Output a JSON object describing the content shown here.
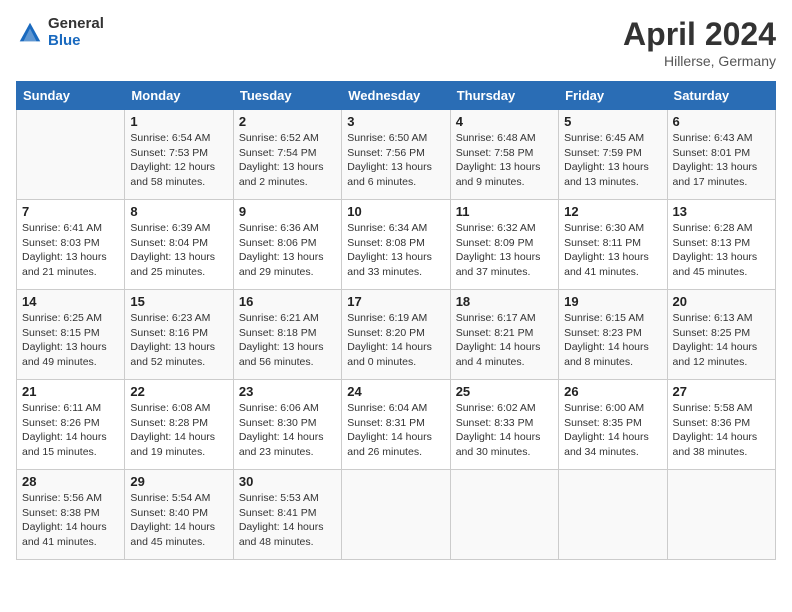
{
  "header": {
    "logo_general": "General",
    "logo_blue": "Blue",
    "month_title": "April 2024",
    "location": "Hillerse, Germany"
  },
  "days_of_week": [
    "Sunday",
    "Monday",
    "Tuesday",
    "Wednesday",
    "Thursday",
    "Friday",
    "Saturday"
  ],
  "weeks": [
    [
      {
        "day": "",
        "info": ""
      },
      {
        "day": "1",
        "info": "Sunrise: 6:54 AM\nSunset: 7:53 PM\nDaylight: 12 hours\nand 58 minutes."
      },
      {
        "day": "2",
        "info": "Sunrise: 6:52 AM\nSunset: 7:54 PM\nDaylight: 13 hours\nand 2 minutes."
      },
      {
        "day": "3",
        "info": "Sunrise: 6:50 AM\nSunset: 7:56 PM\nDaylight: 13 hours\nand 6 minutes."
      },
      {
        "day": "4",
        "info": "Sunrise: 6:48 AM\nSunset: 7:58 PM\nDaylight: 13 hours\nand 9 minutes."
      },
      {
        "day": "5",
        "info": "Sunrise: 6:45 AM\nSunset: 7:59 PM\nDaylight: 13 hours\nand 13 minutes."
      },
      {
        "day": "6",
        "info": "Sunrise: 6:43 AM\nSunset: 8:01 PM\nDaylight: 13 hours\nand 17 minutes."
      }
    ],
    [
      {
        "day": "7",
        "info": "Sunrise: 6:41 AM\nSunset: 8:03 PM\nDaylight: 13 hours\nand 21 minutes."
      },
      {
        "day": "8",
        "info": "Sunrise: 6:39 AM\nSunset: 8:04 PM\nDaylight: 13 hours\nand 25 minutes."
      },
      {
        "day": "9",
        "info": "Sunrise: 6:36 AM\nSunset: 8:06 PM\nDaylight: 13 hours\nand 29 minutes."
      },
      {
        "day": "10",
        "info": "Sunrise: 6:34 AM\nSunset: 8:08 PM\nDaylight: 13 hours\nand 33 minutes."
      },
      {
        "day": "11",
        "info": "Sunrise: 6:32 AM\nSunset: 8:09 PM\nDaylight: 13 hours\nand 37 minutes."
      },
      {
        "day": "12",
        "info": "Sunrise: 6:30 AM\nSunset: 8:11 PM\nDaylight: 13 hours\nand 41 minutes."
      },
      {
        "day": "13",
        "info": "Sunrise: 6:28 AM\nSunset: 8:13 PM\nDaylight: 13 hours\nand 45 minutes."
      }
    ],
    [
      {
        "day": "14",
        "info": "Sunrise: 6:25 AM\nSunset: 8:15 PM\nDaylight: 13 hours\nand 49 minutes."
      },
      {
        "day": "15",
        "info": "Sunrise: 6:23 AM\nSunset: 8:16 PM\nDaylight: 13 hours\nand 52 minutes."
      },
      {
        "day": "16",
        "info": "Sunrise: 6:21 AM\nSunset: 8:18 PM\nDaylight: 13 hours\nand 56 minutes."
      },
      {
        "day": "17",
        "info": "Sunrise: 6:19 AM\nSunset: 8:20 PM\nDaylight: 14 hours\nand 0 minutes."
      },
      {
        "day": "18",
        "info": "Sunrise: 6:17 AM\nSunset: 8:21 PM\nDaylight: 14 hours\nand 4 minutes."
      },
      {
        "day": "19",
        "info": "Sunrise: 6:15 AM\nSunset: 8:23 PM\nDaylight: 14 hours\nand 8 minutes."
      },
      {
        "day": "20",
        "info": "Sunrise: 6:13 AM\nSunset: 8:25 PM\nDaylight: 14 hours\nand 12 minutes."
      }
    ],
    [
      {
        "day": "21",
        "info": "Sunrise: 6:11 AM\nSunset: 8:26 PM\nDaylight: 14 hours\nand 15 minutes."
      },
      {
        "day": "22",
        "info": "Sunrise: 6:08 AM\nSunset: 8:28 PM\nDaylight: 14 hours\nand 19 minutes."
      },
      {
        "day": "23",
        "info": "Sunrise: 6:06 AM\nSunset: 8:30 PM\nDaylight: 14 hours\nand 23 minutes."
      },
      {
        "day": "24",
        "info": "Sunrise: 6:04 AM\nSunset: 8:31 PM\nDaylight: 14 hours\nand 26 minutes."
      },
      {
        "day": "25",
        "info": "Sunrise: 6:02 AM\nSunset: 8:33 PM\nDaylight: 14 hours\nand 30 minutes."
      },
      {
        "day": "26",
        "info": "Sunrise: 6:00 AM\nSunset: 8:35 PM\nDaylight: 14 hours\nand 34 minutes."
      },
      {
        "day": "27",
        "info": "Sunrise: 5:58 AM\nSunset: 8:36 PM\nDaylight: 14 hours\nand 38 minutes."
      }
    ],
    [
      {
        "day": "28",
        "info": "Sunrise: 5:56 AM\nSunset: 8:38 PM\nDaylight: 14 hours\nand 41 minutes."
      },
      {
        "day": "29",
        "info": "Sunrise: 5:54 AM\nSunset: 8:40 PM\nDaylight: 14 hours\nand 45 minutes."
      },
      {
        "day": "30",
        "info": "Sunrise: 5:53 AM\nSunset: 8:41 PM\nDaylight: 14 hours\nand 48 minutes."
      },
      {
        "day": "",
        "info": ""
      },
      {
        "day": "",
        "info": ""
      },
      {
        "day": "",
        "info": ""
      },
      {
        "day": "",
        "info": ""
      }
    ]
  ]
}
